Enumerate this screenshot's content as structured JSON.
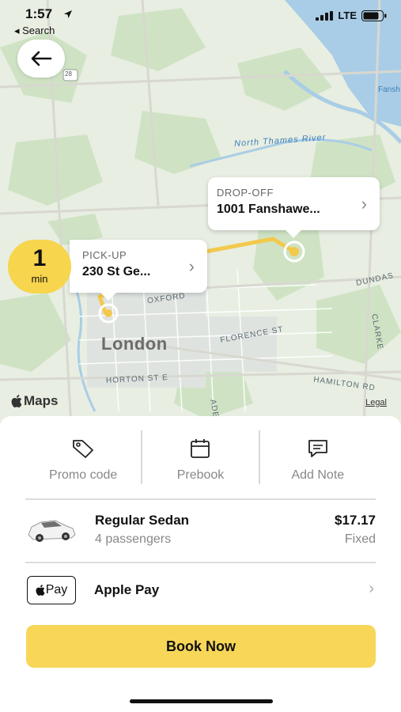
{
  "status": {
    "time": "1:57",
    "back_label": "◂ Search",
    "network": "LTE"
  },
  "map": {
    "city": "London",
    "river": "North Thames River",
    "streets": [
      "OXFORD",
      "FLORENCE ST",
      "HORTON ST E",
      "DUNDAS",
      "HAMILTON RD",
      "CLARKE",
      "ADEL"
    ],
    "fanshawe_partial": "Fansh",
    "highway_shield": "28",
    "brand": "Maps",
    "legal": "Legal"
  },
  "eta": {
    "value": "1",
    "unit": "min"
  },
  "pickup": {
    "label": "PICK-UP",
    "address": "230 St Ge..."
  },
  "dropoff": {
    "label": "DROP-OFF",
    "address": "1001 Fanshawe..."
  },
  "actions": {
    "promo": "Promo code",
    "prebook": "Prebook",
    "note": "Add Note"
  },
  "ride": {
    "name": "Regular Sedan",
    "passengers": "4 passengers",
    "price": "$17.17",
    "price_type": "Fixed"
  },
  "payment": {
    "badge": "Pay",
    "method": "Apple Pay"
  },
  "book_button": "Book Now",
  "colors": {
    "accent": "#f7d658",
    "route": "#f2c94c",
    "water": "#a9cde6"
  }
}
